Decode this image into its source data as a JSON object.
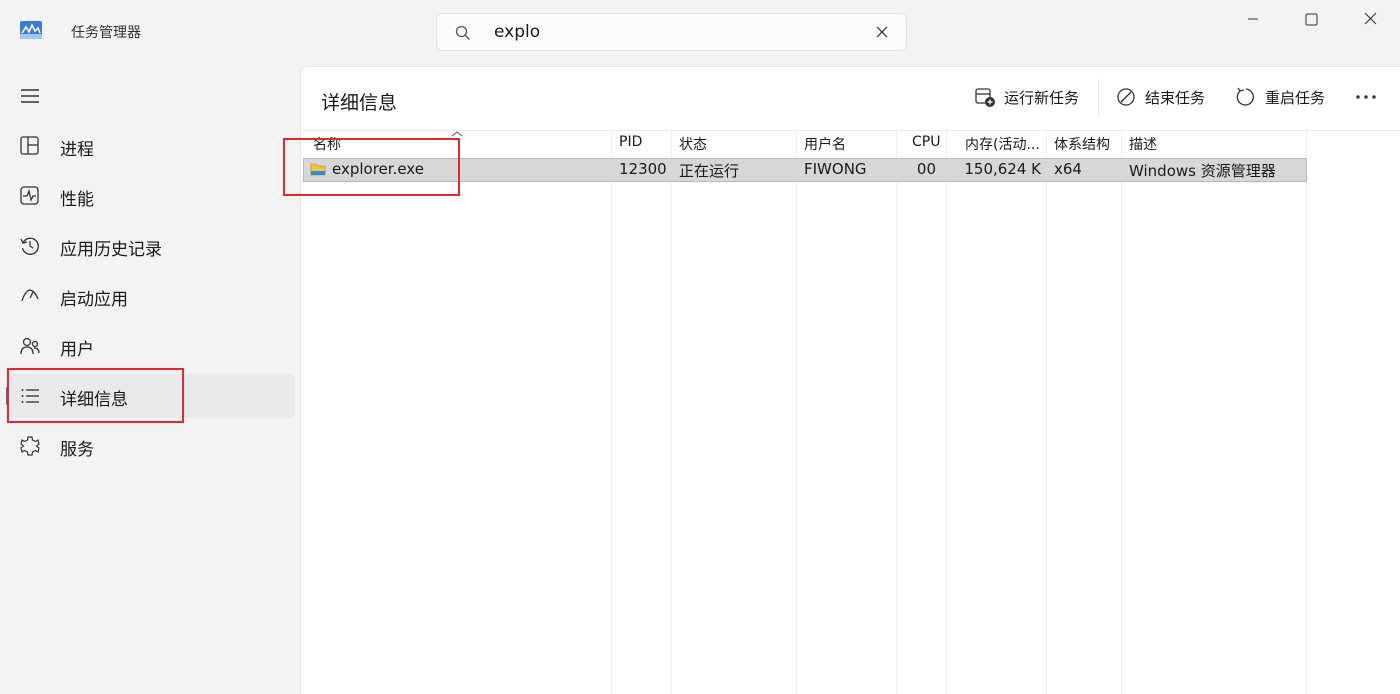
{
  "app": {
    "title": "任务管理器",
    "search": {
      "value": "explo",
      "placeholder": ""
    }
  },
  "sidebar": {
    "items": [
      {
        "label": "进程",
        "icon": "processes-icon"
      },
      {
        "label": "性能",
        "icon": "performance-icon"
      },
      {
        "label": "应用历史记录",
        "icon": "history-icon"
      },
      {
        "label": "启动应用",
        "icon": "startup-icon"
      },
      {
        "label": "用户",
        "icon": "users-icon"
      },
      {
        "label": "详细信息",
        "icon": "details-icon",
        "active": true
      },
      {
        "label": "服务",
        "icon": "services-icon"
      }
    ]
  },
  "content": {
    "title": "详细信息",
    "commands": {
      "run_new_task": "运行新任务",
      "end_task": "结束任务",
      "restart_task": "重启任务"
    },
    "table": {
      "columns": [
        "名称",
        "PID",
        "状态",
        "用户名",
        "CPU",
        "内存(活动...",
        "体系结构",
        "描述"
      ],
      "rows": [
        {
          "name": "explorer.exe",
          "pid": "12300",
          "status": "正在运行",
          "user": "FIWONG",
          "cpu": "00",
          "memory": "150,624 K",
          "arch": "x64",
          "description": "Windows 资源管理器"
        }
      ]
    }
  },
  "colors": {
    "accent": "#4b6aa7",
    "highlight": "#e0282e",
    "selected_row": "#d7d7d7"
  }
}
